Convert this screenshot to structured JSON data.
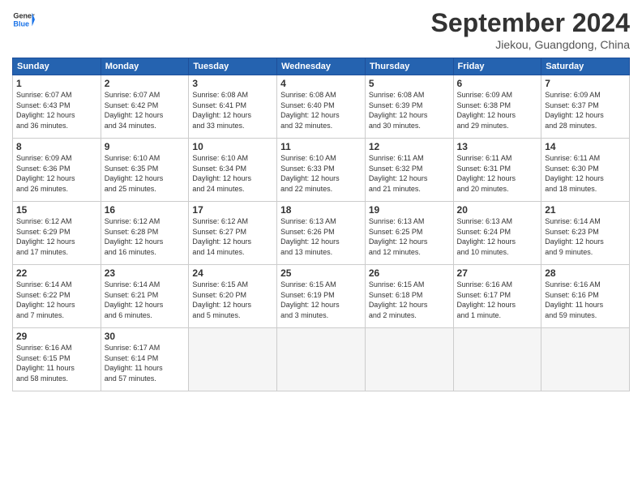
{
  "header": {
    "logo_line1": "General",
    "logo_line2": "Blue",
    "month": "September 2024",
    "location": "Jiekou, Guangdong, China"
  },
  "weekdays": [
    "Sunday",
    "Monday",
    "Tuesday",
    "Wednesday",
    "Thursday",
    "Friday",
    "Saturday"
  ],
  "weeks": [
    [
      {
        "day": 1,
        "info": "Sunrise: 6:07 AM\nSunset: 6:43 PM\nDaylight: 12 hours\nand 36 minutes."
      },
      {
        "day": 2,
        "info": "Sunrise: 6:07 AM\nSunset: 6:42 PM\nDaylight: 12 hours\nand 34 minutes."
      },
      {
        "day": 3,
        "info": "Sunrise: 6:08 AM\nSunset: 6:41 PM\nDaylight: 12 hours\nand 33 minutes."
      },
      {
        "day": 4,
        "info": "Sunrise: 6:08 AM\nSunset: 6:40 PM\nDaylight: 12 hours\nand 32 minutes."
      },
      {
        "day": 5,
        "info": "Sunrise: 6:08 AM\nSunset: 6:39 PM\nDaylight: 12 hours\nand 30 minutes."
      },
      {
        "day": 6,
        "info": "Sunrise: 6:09 AM\nSunset: 6:38 PM\nDaylight: 12 hours\nand 29 minutes."
      },
      {
        "day": 7,
        "info": "Sunrise: 6:09 AM\nSunset: 6:37 PM\nDaylight: 12 hours\nand 28 minutes."
      }
    ],
    [
      {
        "day": 8,
        "info": "Sunrise: 6:09 AM\nSunset: 6:36 PM\nDaylight: 12 hours\nand 26 minutes."
      },
      {
        "day": 9,
        "info": "Sunrise: 6:10 AM\nSunset: 6:35 PM\nDaylight: 12 hours\nand 25 minutes."
      },
      {
        "day": 10,
        "info": "Sunrise: 6:10 AM\nSunset: 6:34 PM\nDaylight: 12 hours\nand 24 minutes."
      },
      {
        "day": 11,
        "info": "Sunrise: 6:10 AM\nSunset: 6:33 PM\nDaylight: 12 hours\nand 22 minutes."
      },
      {
        "day": 12,
        "info": "Sunrise: 6:11 AM\nSunset: 6:32 PM\nDaylight: 12 hours\nand 21 minutes."
      },
      {
        "day": 13,
        "info": "Sunrise: 6:11 AM\nSunset: 6:31 PM\nDaylight: 12 hours\nand 20 minutes."
      },
      {
        "day": 14,
        "info": "Sunrise: 6:11 AM\nSunset: 6:30 PM\nDaylight: 12 hours\nand 18 minutes."
      }
    ],
    [
      {
        "day": 15,
        "info": "Sunrise: 6:12 AM\nSunset: 6:29 PM\nDaylight: 12 hours\nand 17 minutes."
      },
      {
        "day": 16,
        "info": "Sunrise: 6:12 AM\nSunset: 6:28 PM\nDaylight: 12 hours\nand 16 minutes."
      },
      {
        "day": 17,
        "info": "Sunrise: 6:12 AM\nSunset: 6:27 PM\nDaylight: 12 hours\nand 14 minutes."
      },
      {
        "day": 18,
        "info": "Sunrise: 6:13 AM\nSunset: 6:26 PM\nDaylight: 12 hours\nand 13 minutes."
      },
      {
        "day": 19,
        "info": "Sunrise: 6:13 AM\nSunset: 6:25 PM\nDaylight: 12 hours\nand 12 minutes."
      },
      {
        "day": 20,
        "info": "Sunrise: 6:13 AM\nSunset: 6:24 PM\nDaylight: 12 hours\nand 10 minutes."
      },
      {
        "day": 21,
        "info": "Sunrise: 6:14 AM\nSunset: 6:23 PM\nDaylight: 12 hours\nand 9 minutes."
      }
    ],
    [
      {
        "day": 22,
        "info": "Sunrise: 6:14 AM\nSunset: 6:22 PM\nDaylight: 12 hours\nand 7 minutes."
      },
      {
        "day": 23,
        "info": "Sunrise: 6:14 AM\nSunset: 6:21 PM\nDaylight: 12 hours\nand 6 minutes."
      },
      {
        "day": 24,
        "info": "Sunrise: 6:15 AM\nSunset: 6:20 PM\nDaylight: 12 hours\nand 5 minutes."
      },
      {
        "day": 25,
        "info": "Sunrise: 6:15 AM\nSunset: 6:19 PM\nDaylight: 12 hours\nand 3 minutes."
      },
      {
        "day": 26,
        "info": "Sunrise: 6:15 AM\nSunset: 6:18 PM\nDaylight: 12 hours\nand 2 minutes."
      },
      {
        "day": 27,
        "info": "Sunrise: 6:16 AM\nSunset: 6:17 PM\nDaylight: 12 hours\nand 1 minute."
      },
      {
        "day": 28,
        "info": "Sunrise: 6:16 AM\nSunset: 6:16 PM\nDaylight: 11 hours\nand 59 minutes."
      }
    ],
    [
      {
        "day": 29,
        "info": "Sunrise: 6:16 AM\nSunset: 6:15 PM\nDaylight: 11 hours\nand 58 minutes."
      },
      {
        "day": 30,
        "info": "Sunrise: 6:17 AM\nSunset: 6:14 PM\nDaylight: 11 hours\nand 57 minutes."
      },
      {
        "day": null
      },
      {
        "day": null
      },
      {
        "day": null
      },
      {
        "day": null
      },
      {
        "day": null
      }
    ]
  ]
}
